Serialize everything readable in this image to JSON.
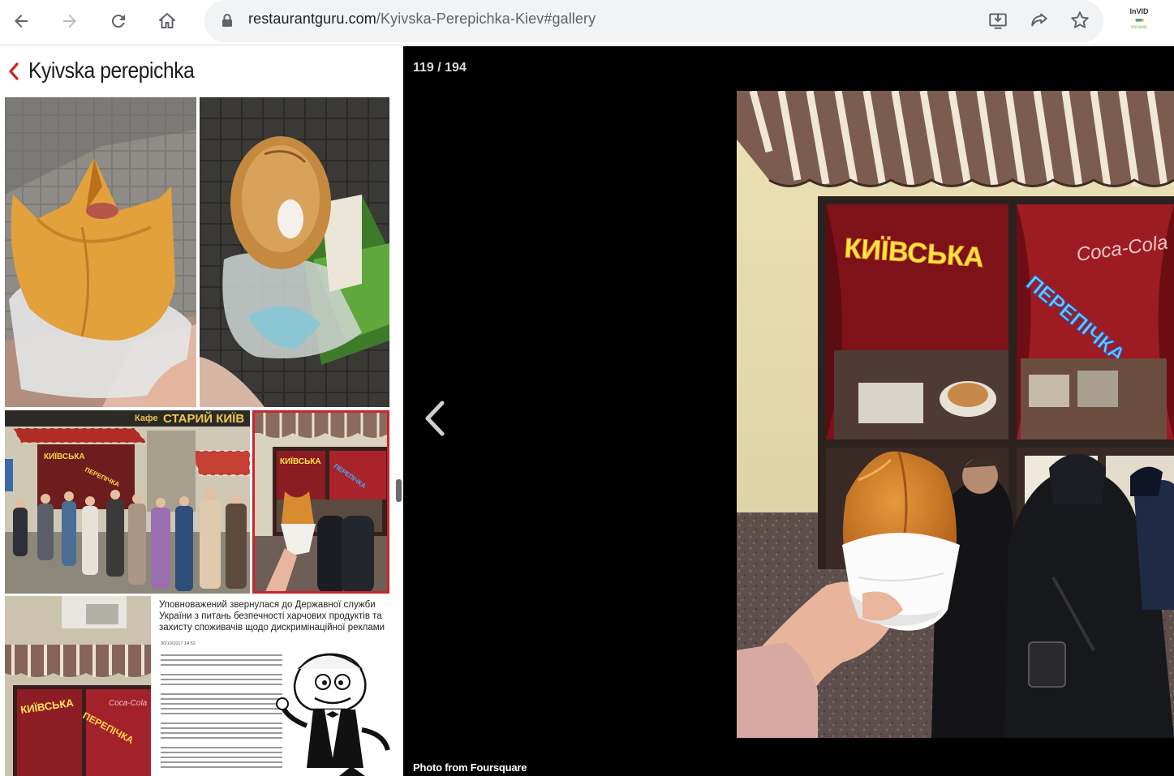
{
  "browser": {
    "url_host": "restaurantguru.com",
    "url_path": "/Kyivska-Perepichka-Kiev#gallery",
    "extension": {
      "name": "InVID",
      "sub": "WeVerify"
    }
  },
  "sidebar": {
    "title": "Kyivska perepichka"
  },
  "thumbnails": [
    {
      "name": "thumb-pastry-bitten"
    },
    {
      "name": "thumb-pastry-dark"
    },
    {
      "name": "thumb-queue-street"
    },
    {
      "name": "thumb-kiosk-selected",
      "selected": true
    },
    {
      "name": "thumb-kiosk-signage"
    },
    {
      "name": "thumb-article-cartoon"
    }
  ],
  "article": {
    "headline": "Уповноважений звернулася до Державної служби України з питань безпечності харчових продуктів та захисту споживачів щодо дискримінаційної реклами",
    "date": "30/10/2017 14:52"
  },
  "store_signs": {
    "kyivska": "КИЇВСЬКА",
    "perepichka": "ПЕРЕПІЧКА",
    "cafe": "Кафе",
    "cafe_name": "СТАРИЙ КИЇВ",
    "cola": "Coca-Cola"
  },
  "viewer": {
    "counter": "119 / 194",
    "credit": "Photo from Foursquare"
  },
  "colors": {
    "accent_red": "#c9252c",
    "viewer_bg": "#000000"
  }
}
